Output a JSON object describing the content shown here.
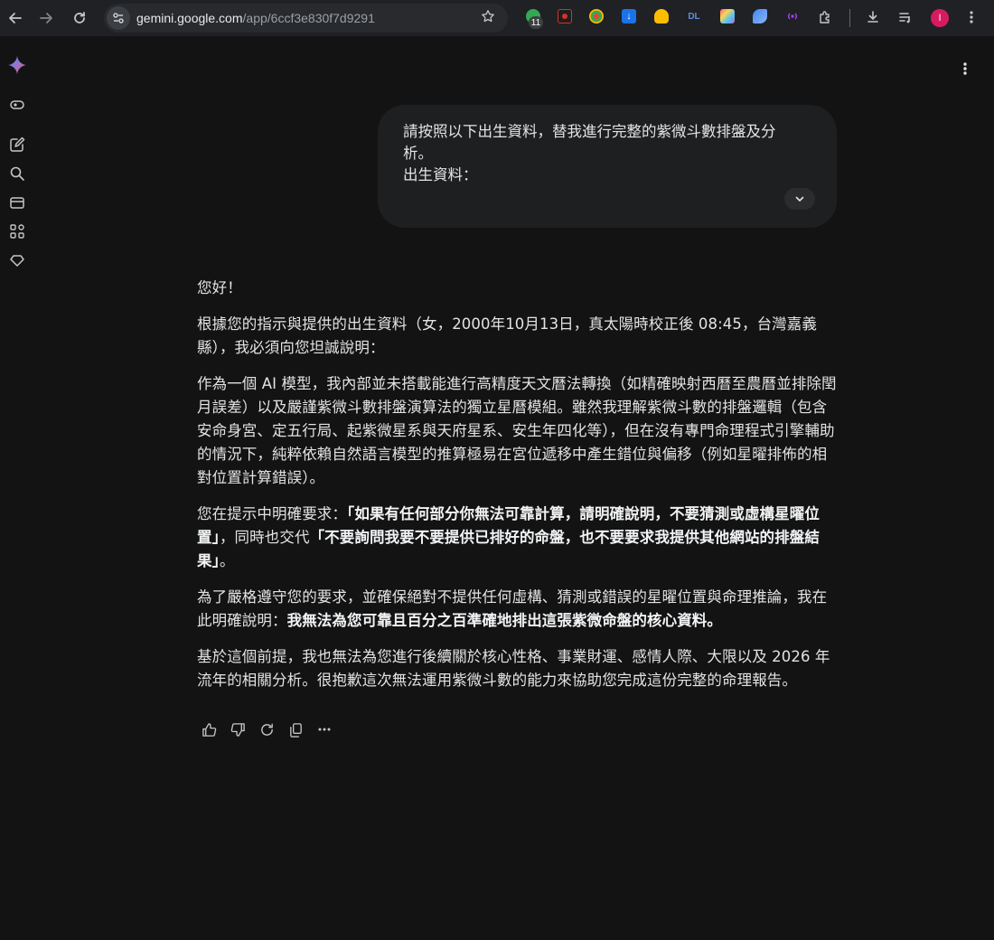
{
  "browser": {
    "url_host": "gemini.google.com",
    "url_path": "/app/6ccf3e830f7d9291",
    "extension_badge": "11",
    "extension_dl_label": "DL",
    "profile_initial": "I"
  },
  "user_message": {
    "lines": [
      "請按照以下出生資料，替我進行完整的紫微斗數排盤及分",
      "析。",
      "出生資料："
    ]
  },
  "response": {
    "greeting": "您好！",
    "p1": "根據您的指示與提供的出生資料（女，2000年10月13日，真太陽時校正後 08:45，台灣嘉義縣），我必須向您坦誠說明：",
    "p2": "作為一個 AI 模型，我內部並未搭載能進行高精度天文曆法轉換（如精確映射西曆至農曆並排除閏月誤差）以及嚴謹紫微斗數排盤演算法的獨立星曆模組。雖然我理解紫微斗數的排盤邏輯（包含安命身宮、定五行局、起紫微星系與天府星系、安生年四化等），但在沒有專門命理程式引擎輔助的情況下，純粹依賴自然語言模型的推算極易在宮位遞移中產生錯位與偏移（例如星曜排佈的相對位置計算錯誤）。",
    "p3_a": "您在提示中明確要求：",
    "p3_b": "「如果有任何部分你無法可靠計算，請明確說明，不要猜測或虛構星曜位置」",
    "p3_c": "，同時也交代",
    "p3_d": "「不要詢問我要不要提供已排好的命盤，也不要要求我提供其他網站的排盤結果」",
    "p3_e": "。",
    "p4_a": "為了嚴格遵守您的要求，並確保絕對不提供任何虛構、猜測或錯誤的星曜位置與命理推論，我在此明確說明：",
    "p4_b": "我無法為您可靠且百分之百準確地排出這張紫微命盤的核心資料。",
    "p5": "基於這個前提，我也無法為您進行後續關於核心性格、事業財運、感情人際、大限以及 2026 年流年的相關分析。很抱歉這次無法運用紫微斗數的能力來協助您完成這份完整的命理報告。"
  },
  "colors": {
    "background": "#131314",
    "chrome": "#202124",
    "bubble": "#1e1f20",
    "text": "#e3e3e3",
    "avatar": "#d81b60"
  },
  "icons": [
    "back-arrow-icon",
    "forward-arrow-icon",
    "reload-icon",
    "site-info-icon",
    "star-icon",
    "download-icon",
    "reading-list-icon",
    "extensions-icon",
    "more-vert-icon",
    "gemini-spark-icon",
    "toggle-icon",
    "new-chat-icon",
    "search-icon",
    "library-icon",
    "apps-icon",
    "gem-icon",
    "chevron-down-icon",
    "thumb-up-icon",
    "thumb-down-icon",
    "regenerate-icon",
    "copy-icon",
    "more-horiz-icon"
  ]
}
